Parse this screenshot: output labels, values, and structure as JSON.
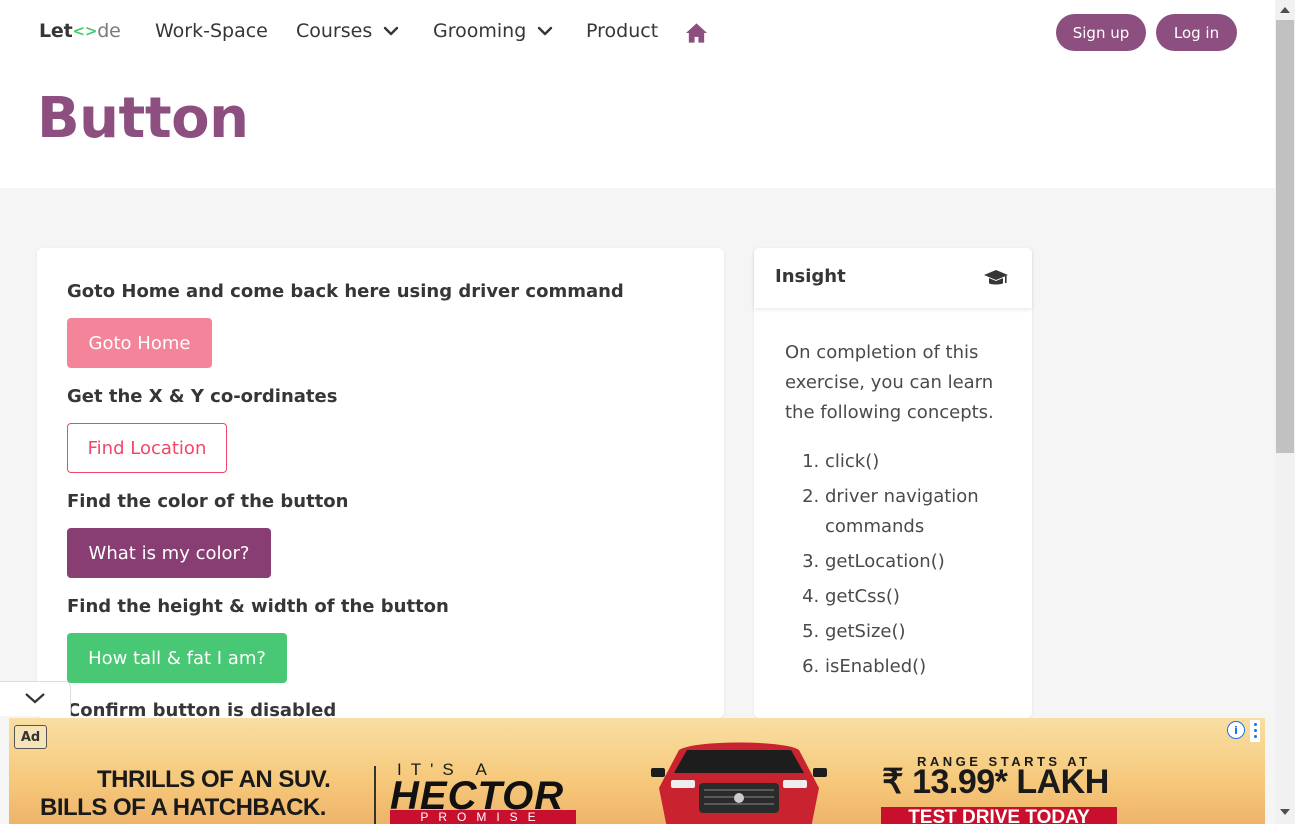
{
  "nav": {
    "logo_prefix": "Let",
    "logo_bracket": "<>",
    "logo_suffix": "de",
    "items": [
      {
        "label": "Work-Space"
      },
      {
        "label": "Courses"
      },
      {
        "label": "Grooming"
      },
      {
        "label": "Product"
      }
    ],
    "signup_label": "Sign up",
    "login_label": "Log in",
    "home_icon": "home-icon",
    "dropdown_icon": "chevron-down-icon"
  },
  "hero": {
    "title": "Button"
  },
  "tasks": {
    "goto_label": "Goto Home and come back here using driver command",
    "goto_button": "Goto Home",
    "location_label": "Get the X & Y co-ordinates",
    "location_button": "Find Location",
    "color_label": "Find the color of the button",
    "color_button": "What is my color?",
    "size_label": "Find the height & width of the button",
    "size_button": "How tall & fat I am?",
    "disabled_label": "Confirm button is disabled"
  },
  "insight": {
    "title": "Insight",
    "icon": "graduation-cap-icon",
    "description": "On completion of this exercise, you can learn the following concepts.",
    "concepts": [
      "click()",
      "driver navigation commands",
      "getLocation()",
      "getCss()",
      "getSize()",
      "isEnabled()"
    ]
  },
  "ad": {
    "badge": "Ad",
    "line1": "THRILLS OF AN SUV.",
    "line2": "BILLS OF A HATCHBACK.",
    "its_a": "IT'S A",
    "brand": "HECTOR",
    "promise": "PROMISE",
    "range": "RANGE STARTS AT",
    "price": "₹ 13.99* LAKH",
    "cta": "TEST DRIVE TODAY",
    "info_icon": "info-icon",
    "menu_icon": "more-vert-icon"
  },
  "colors": {
    "brand_purple": "#8d4f7f",
    "goto_pink": "#f38499",
    "find_red": "#f14668",
    "color_button": "#883d73",
    "success_green": "#48c774"
  }
}
